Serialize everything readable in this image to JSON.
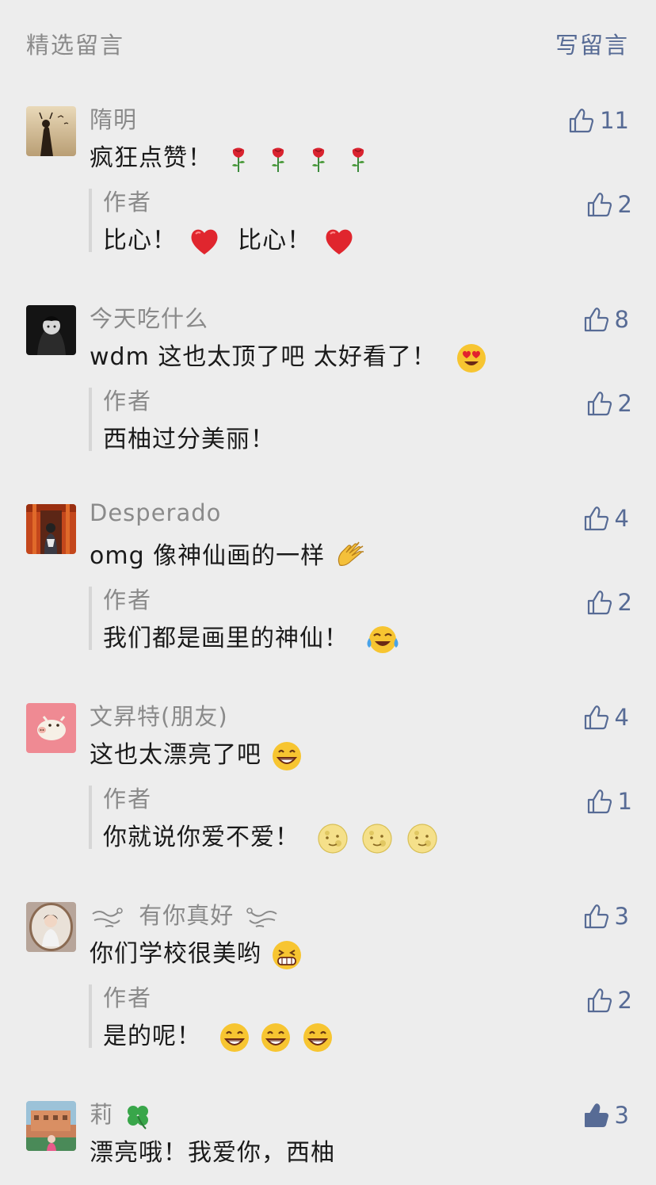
{
  "header": {
    "title": "精选留言",
    "write": "写留言"
  },
  "comments": [
    {
      "nick": "隋明",
      "text": "疯狂点赞！",
      "likes": "11",
      "reply": {
        "name": "作者",
        "text": "比心！",
        "text2": "比心！",
        "likes": "2"
      }
    },
    {
      "nick": "今天吃什么",
      "text": "wdm 这也太顶了吧  太好看了！",
      "likes": "8",
      "reply": {
        "name": "作者",
        "text": "西柚过分美丽！",
        "likes": "2"
      }
    },
    {
      "nick": "Desperado",
      "text": "omg 像神仙画的一样",
      "likes": "4",
      "reply": {
        "name": "作者",
        "text": "我们都是画里的神仙！",
        "likes": "2"
      }
    },
    {
      "nick": "文昇特(朋友)",
      "text": "这也太漂亮了吧",
      "likes": "4",
      "reply": {
        "name": "作者",
        "text": "你就说你爱不爱！",
        "likes": "1"
      }
    },
    {
      "nick": "有你真好",
      "text": "你们学校很美哟",
      "likes": "3",
      "reply": {
        "name": "作者",
        "text": "是的呢！",
        "likes": "2"
      }
    },
    {
      "nick": "莉",
      "text": "漂亮哦！我爱你，西柚",
      "likes": "3"
    }
  ]
}
